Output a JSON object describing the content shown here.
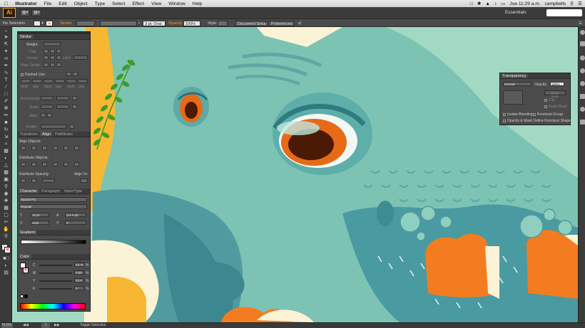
{
  "menubar": {
    "app_name": "Illustrator",
    "items": [
      "File",
      "Edit",
      "Object",
      "Type",
      "Select",
      "Effect",
      "View",
      "Window",
      "Help"
    ],
    "clock": "Jue 11:29 a.m.",
    "user": "campbells"
  },
  "appbar": {
    "logo": "Ai",
    "workspace": "Essentials"
  },
  "control": {
    "selection": "No Selection",
    "stroke_label": "Stroke:",
    "brush": "3 pt. Oval",
    "opacity_label": "Opacity:",
    "opacity_value": "100%",
    "style_label": "Style:",
    "document_setup": "Document Setup",
    "preferences": "Preferences"
  },
  "stroke_panel": {
    "title": "Stroke",
    "weight": "Weight:",
    "cap": "Cap:",
    "corner": "Corner:",
    "limit": "Limit:",
    "align": "Align Stroke:",
    "dashed": "Dashed Line",
    "dash_labels": [
      "dash",
      "gap",
      "dash",
      "gap",
      "dash",
      "gap"
    ],
    "arrowheads": "Arrowheads:",
    "scale": "Scale:",
    "align2": "Align:",
    "profile": "Profile:"
  },
  "align_panel": {
    "tabs": [
      "Transform",
      "Align",
      "Pathfinder"
    ],
    "align_objects": "Align Objects:",
    "distribute_objects": "Distribute Objects:",
    "distribute_spacing": "Distribute Spacing:",
    "align_to": "Align To:"
  },
  "character_panel": {
    "tabs": [
      "Character",
      "Paragraph",
      "OpenType"
    ],
    "font": "Myriad Pro",
    "style": "Regular",
    "size": "12 pt",
    "leading": "(14.4 pt)",
    "tracking_auto": "Auto",
    "tracking": "0"
  },
  "gradient_panel": {
    "title": "Gradient"
  },
  "color_panel": {
    "title": "Color",
    "channels": [
      {
        "label": "C",
        "value": "23.72",
        "unit": "%",
        "color": "#00aeef"
      },
      {
        "label": "M",
        "value": "0.09",
        "unit": "%",
        "color": "#ec008c"
      },
      {
        "label": "Y",
        "value": "22.0",
        "unit": "%",
        "color": "#fff200"
      },
      {
        "label": "K",
        "value": "0",
        "unit": "%",
        "color": "#000000"
      }
    ]
  },
  "transparency_panel": {
    "title": "Transparency",
    "mode": "Normal",
    "opacity_label": "Opacity:",
    "opacity_value": "100%",
    "make_mask": "Make Mask",
    "clip": "Clip",
    "invert_mask": "Invert Mask",
    "isolate": "Isolate Blending",
    "knockout": "Knockout Group",
    "opacity_mask": "Opacity & Mask Define Knockout Shape"
  },
  "status": {
    "zoom": "76.8%",
    "page": "1",
    "tool_hint": "Toggle Selection"
  },
  "colors": {
    "background": "#9fd8c1",
    "creature": "#7cc3b3",
    "creature_shadow": "#4a9aa1",
    "eye": "#e76a17",
    "pupil": "#4a1a05",
    "accent_orange": "#f47c20",
    "accent_yellow": "#f7b733",
    "leaf": "#3f9a2a"
  }
}
